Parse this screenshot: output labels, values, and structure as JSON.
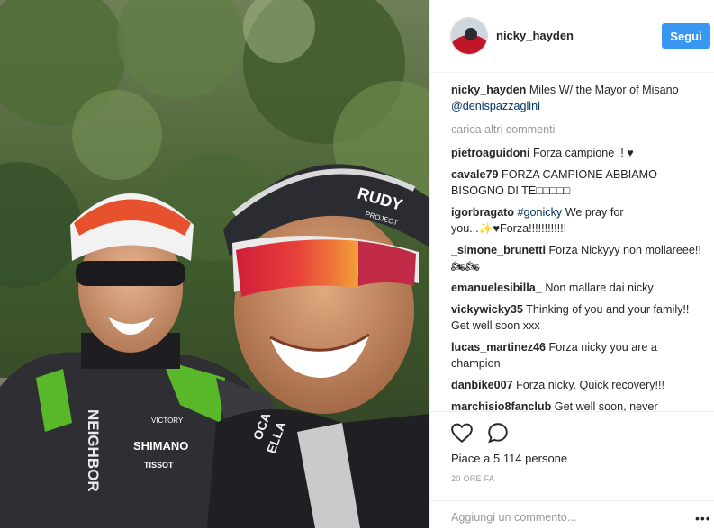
{
  "post": {
    "username": "nicky_hayden",
    "follow_label": "Segui",
    "caption_user": "nicky_hayden",
    "caption_text": "Miles W/ the Mayor of Misano",
    "caption_mention": "@denispazzaglini",
    "load_more": "carica altri commenti",
    "likes": "Piace a 5.114 persone",
    "time": "20 ORE FA",
    "add_comment_placeholder": "Aggiungi un commento...",
    "more_options": "•••"
  },
  "comments": [
    {
      "user": "pietroaguidoni",
      "text": "Forza campione !! ♥"
    },
    {
      "user": "cavale79",
      "text": "FORZA CAMPIONE ABBIAMO BISOGNO DI TE□□□□□"
    },
    {
      "user": "igorbragato",
      "tag": "#gonicky",
      "text": "We pray for you...✨♥Forza!!!!!!!!!!!!"
    },
    {
      "user": "_simone_brunetti",
      "text": "Forza Nickyyy non mollareee!! 🏍🏍"
    },
    {
      "user": "emanuelesibilla_",
      "text": "Non mallare dai nicky"
    },
    {
      "user": "vickywicky35",
      "text": "Thinking of you and your family!! Get well soon xxx"
    },
    {
      "user": "lucas_martinez46",
      "text": "Forza nicky you are a champion"
    },
    {
      "user": "danbike007",
      "text": "Forza nicky. Quick recovery!!!"
    },
    {
      "user": "marchisio8fanclub",
      "text": "Get well soon, never"
    }
  ],
  "photo": {
    "jersey_texts": {
      "brand1": "SHIMANO",
      "brand2": "TISSOT",
      "brand3": "VICTORY",
      "sleeve": "NEIGHBOR",
      "helmet": "RUDY",
      "helmet2": "PROJECT",
      "shirt2": "OCA",
      "shirt3": "ELLA"
    }
  },
  "colors": {
    "accent": "#3897f0",
    "mention": "#003569",
    "muted": "#999999",
    "text": "#262626"
  },
  "icons": [
    "heart-icon",
    "comment-icon",
    "more-options-icon"
  ]
}
